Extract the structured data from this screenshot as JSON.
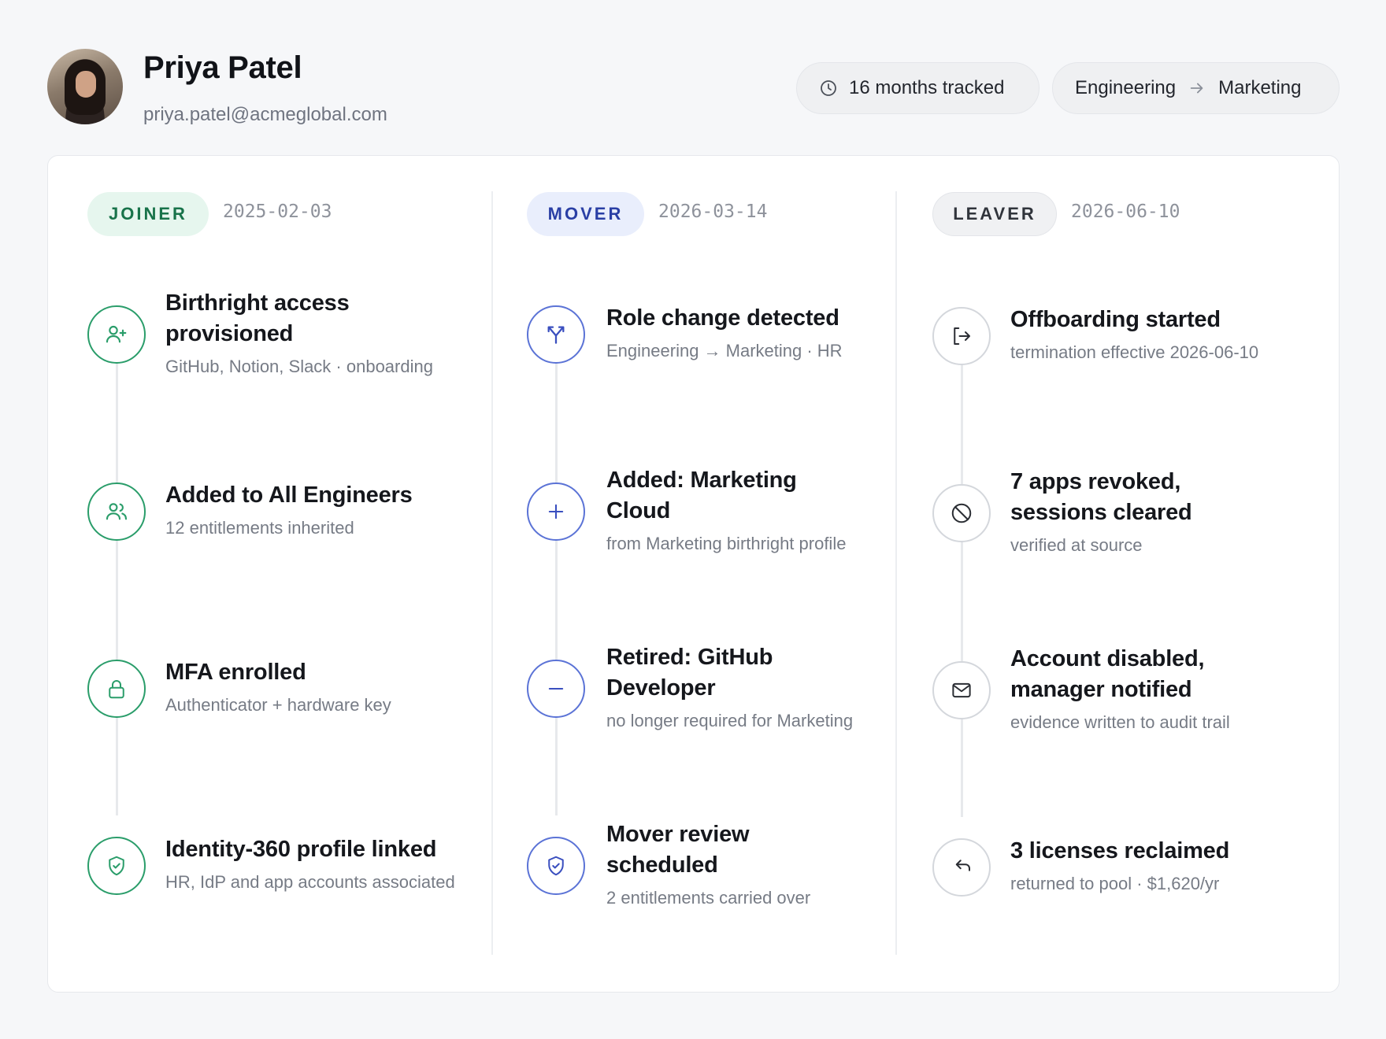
{
  "profile": {
    "name": "Priya Patel",
    "email": "priya.patel@acmeglobal.com",
    "tracked": "16 months tracked",
    "dept_from": "Engineering",
    "dept_to": "Marketing"
  },
  "phases": [
    {
      "label": "JOINER",
      "date": "2025-02-03",
      "color": "#2a9d6a",
      "events": [
        {
          "icon": "user-plus-icon",
          "title": "Birthright access provisioned",
          "sub": "GitHub, Notion, Slack · onboarding"
        },
        {
          "icon": "users-icon",
          "title": "Added to All Engineers",
          "sub": "12 entitlements inherited"
        },
        {
          "icon": "lock-icon",
          "title": "MFA enrolled",
          "sub": "Authenticator + hardware key"
        },
        {
          "icon": "shield-check-icon",
          "title": "Identity-360 profile linked",
          "sub": "HR, IdP and app accounts associated"
        }
      ]
    },
    {
      "label": "MOVER",
      "date": "2026-03-14",
      "color": "#3a4fbf",
      "events": [
        {
          "icon": "split-arrows-icon",
          "title": "Role change detected",
          "sub": "Engineering → Marketing · HR"
        },
        {
          "icon": "plus-icon",
          "title": "Added: Marketing Cloud",
          "sub": "from Marketing birthright profile"
        },
        {
          "icon": "minus-icon",
          "title": "Retired: GitHub Developer",
          "sub": "no longer required for Marketing"
        },
        {
          "icon": "shield-check-icon",
          "title": "Mover review scheduled",
          "sub": "2 entitlements carried over"
        }
      ]
    },
    {
      "label": "LEAVER",
      "date": "2026-06-10",
      "color": "#30343b",
      "events": [
        {
          "icon": "logout-icon",
          "title": "Offboarding started",
          "sub": "termination effective 2026-06-10"
        },
        {
          "icon": "ban-icon",
          "title": "7 apps revoked, sessions cleared",
          "sub": "verified at source"
        },
        {
          "icon": "mail-icon",
          "title": "Account disabled, manager notified",
          "sub": "evidence written to audit trail"
        },
        {
          "icon": "undo-icon",
          "title": "3 licenses reclaimed",
          "sub": "returned to pool · $1,620/yr"
        }
      ]
    }
  ]
}
